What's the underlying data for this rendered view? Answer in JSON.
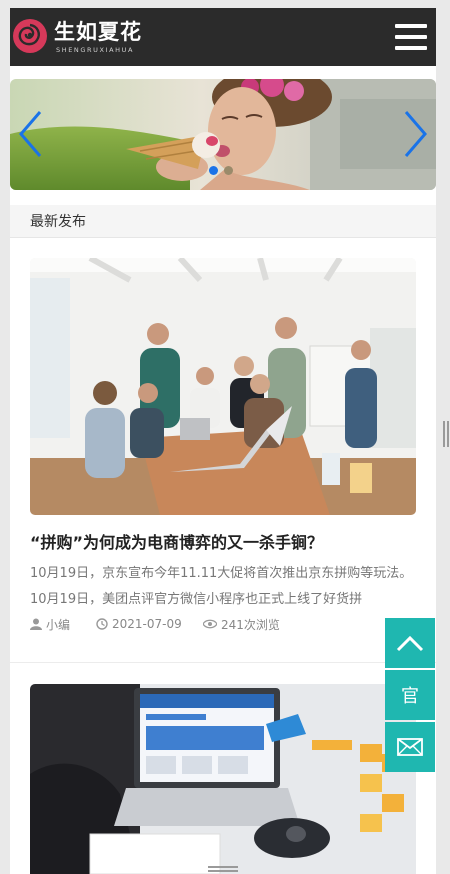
{
  "header": {
    "logo_title": "生如夏花",
    "logo_subtitle": "SHENGRUXIAHUA",
    "menu_icon": "hamburger-menu-icon"
  },
  "banner": {
    "left_icon": "chevron-left-icon",
    "right_icon": "chevron-right-icon",
    "slide_count": 2,
    "active_slide": 1,
    "accent_color": "#1a73e8"
  },
  "section": {
    "title": "最新发布"
  },
  "articles": [
    {
      "title": "“拼购”为何成为电商博弈的又一杀手锏？",
      "summary": "10月19日，京东宣布今年11.11大促将首次推出京东拼购等玩法。10月19日，美团点评官方微信小程序也正式上线了好货拼",
      "author": "小编",
      "date": "2021-07-09",
      "views": "241次浏览"
    },
    {
      "title": "",
      "summary": ""
    }
  ],
  "side_buttons": {
    "top_icon": "chevron-up-icon",
    "guan_label": "官",
    "mail_icon": "mail-icon",
    "color": "#1fb7b0"
  }
}
